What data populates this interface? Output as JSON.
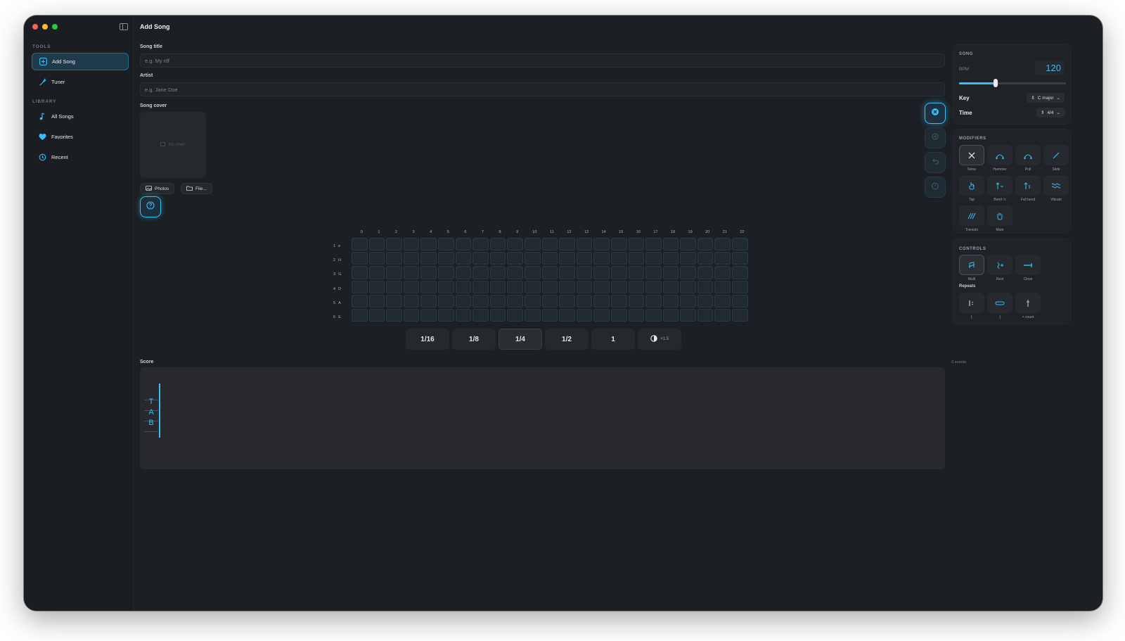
{
  "sidebar": {
    "sections": {
      "tools": "TOOLS",
      "library": "LIBRARY"
    },
    "items": [
      {
        "label": "Add Song",
        "icon": "plus-square-icon"
      },
      {
        "label": "Tuner",
        "icon": "tuning-fork-icon"
      },
      {
        "label": "All Songs",
        "icon": "music-note-icon"
      },
      {
        "label": "Favorites",
        "icon": "heart-icon"
      },
      {
        "label": "Recent",
        "icon": "history-icon"
      }
    ]
  },
  "header": {
    "title": "Add Song"
  },
  "form": {
    "song_title_label": "Song title",
    "song_title_placeholder": "e.g. My riff",
    "artist_label": "Artist",
    "artist_placeholder": "e.g. Jane Doe",
    "cover_label": "Song cover",
    "no_cover": "No cover",
    "photos_btn": "Photos",
    "file_btn": "File..."
  },
  "fretboard": {
    "frets": [
      "0",
      "1",
      "2",
      "3",
      "4",
      "5",
      "6",
      "7",
      "8",
      "9",
      "10",
      "11",
      "12",
      "13",
      "14",
      "15",
      "16",
      "17",
      "18",
      "19",
      "20",
      "21",
      "22"
    ],
    "strings": [
      {
        "num": "1",
        "note": "e"
      },
      {
        "num": "2",
        "note": "H"
      },
      {
        "num": "3",
        "note": "G"
      },
      {
        "num": "4",
        "note": "D"
      },
      {
        "num": "5",
        "note": "A"
      },
      {
        "num": "6",
        "note": "E"
      }
    ]
  },
  "durations": [
    "1/16",
    "1/8",
    "1/4",
    "1/2",
    "1"
  ],
  "selected_duration": "1/4",
  "dot_multiplier": "×1.5",
  "score": {
    "label": "Score",
    "events": "0 events",
    "clef": [
      "T",
      "A",
      "B"
    ]
  },
  "song_panel": {
    "title": "SONG",
    "bpm_label": "BPM",
    "bpm": "120",
    "bpm_fraction": 0.34,
    "key_label": "Key",
    "key_value": "C major",
    "time_label": "Time",
    "time_value": "4/4"
  },
  "modifiers": {
    "title": "MODIFIERS",
    "items": [
      "None",
      "Hammer",
      "Pull",
      "Slide",
      "Tap",
      "Bend ½",
      "Full bend",
      "Vibrato",
      "Tremolo",
      "Mute"
    ]
  },
  "controls": {
    "title": "CONTROLS",
    "items": [
      "Multi",
      "Rest",
      "Close"
    ],
    "repeats_label": "Repeats",
    "repeats": [
      "|:",
      ":|",
      "× count"
    ]
  },
  "colors": {
    "accent": "#38bdf8",
    "window_bg": "#1c1f23"
  }
}
